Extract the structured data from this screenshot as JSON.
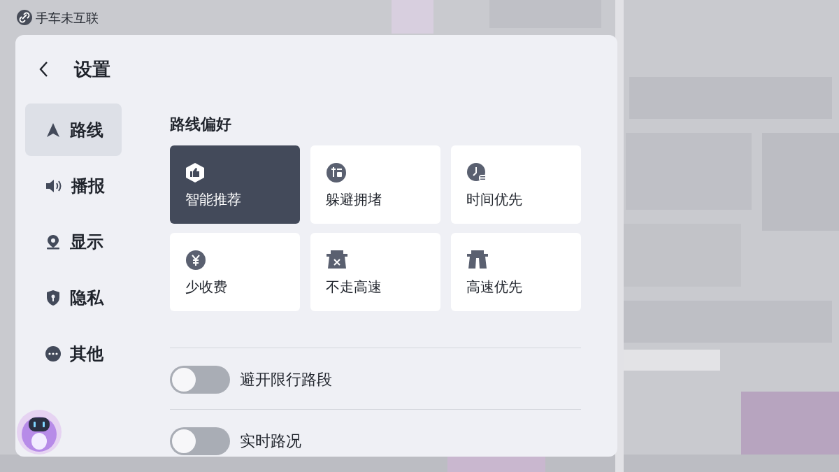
{
  "status": {
    "text": "手车未互联"
  },
  "panel": {
    "title": "设置"
  },
  "sidebar": {
    "items": [
      {
        "label": "路线",
        "selected": true
      },
      {
        "label": "播报",
        "selected": false
      },
      {
        "label": "显示",
        "selected": false
      },
      {
        "label": "隐私",
        "selected": false
      },
      {
        "label": "其他",
        "selected": false
      }
    ]
  },
  "route_preference": {
    "title": "路线偏好",
    "options": [
      {
        "label": "智能推荐",
        "selected": true
      },
      {
        "label": "躲避拥堵",
        "selected": false
      },
      {
        "label": "时间优先",
        "selected": false
      },
      {
        "label": "少收费",
        "selected": false
      },
      {
        "label": "不走高速",
        "selected": false
      },
      {
        "label": "高速优先",
        "selected": false
      }
    ]
  },
  "toggles": [
    {
      "label": "避开限行路段",
      "on": false
    },
    {
      "label": "实时路况",
      "on": false
    }
  ]
}
